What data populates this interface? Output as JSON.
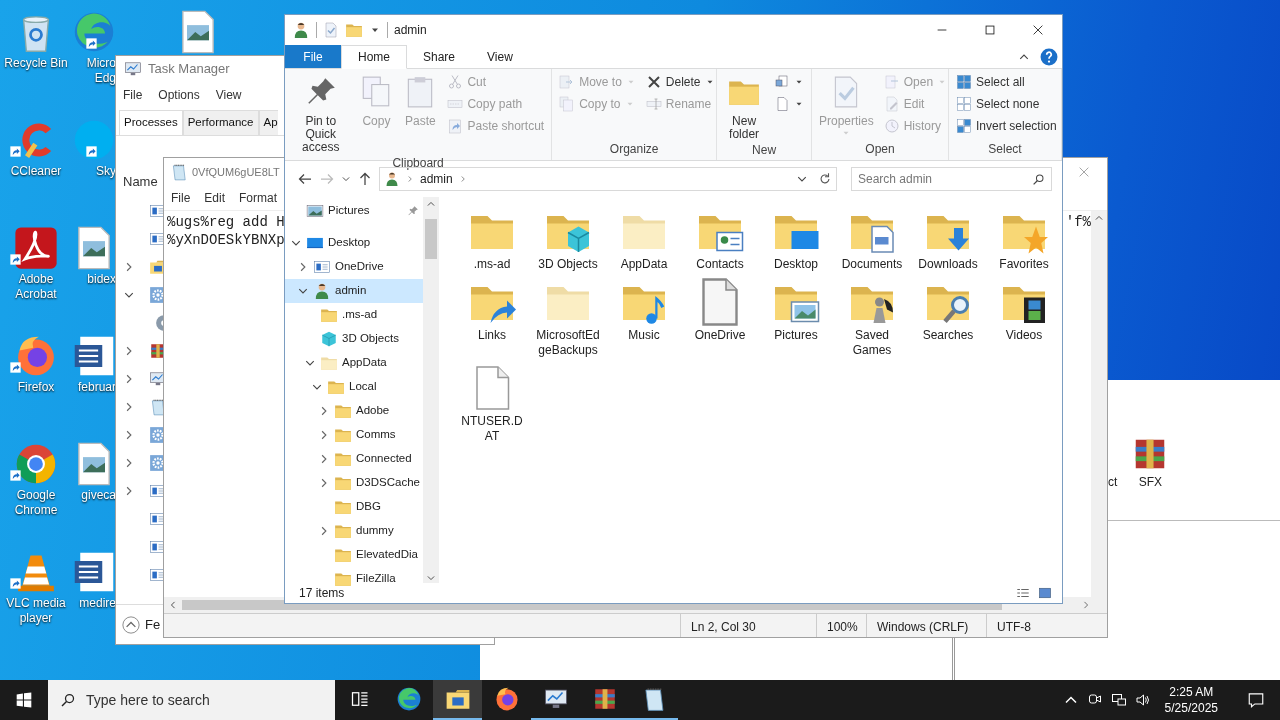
{
  "desktop_columns": [
    [
      {
        "label": "Recycle Bin",
        "kind": "recycle",
        "shortcut": false
      },
      {
        "label": "CCleaner",
        "kind": "ccleaner",
        "shortcut": true
      },
      {
        "label": "Adobe Acrobat",
        "kind": "acrobat",
        "shortcut": true
      },
      {
        "label": "Firefox",
        "kind": "firefox",
        "shortcut": true
      },
      {
        "label": "Google Chrome",
        "kind": "chrome",
        "shortcut": true
      },
      {
        "label": "VLC media player",
        "kind": "vlc",
        "shortcut": true
      }
    ],
    [
      {
        "label": "Micro Edg",
        "kind": "edge",
        "shortcut": true
      },
      {
        "label": "Sky",
        "kind": "skype",
        "shortcut": true
      },
      {
        "label": "bidex",
        "kind": "image",
        "shortcut": false
      },
      {
        "label": "februar",
        "kind": "word",
        "shortcut": false
      },
      {
        "label": "giveca",
        "kind": "image",
        "shortcut": false
      },
      {
        "label": "medire",
        "kind": "word",
        "shortcut": false
      }
    ],
    [
      {
        "kind": "image",
        "shortcut": false
      }
    ]
  ],
  "background_window": {
    "items": [
      {
        "label": "ct",
        "kind": "blank"
      },
      {
        "label": "SFX",
        "kind": "winrar"
      }
    ]
  },
  "task_manager": {
    "title": "Task Manager",
    "menu": [
      "File",
      "Options",
      "View"
    ],
    "tabs": [
      {
        "label": "Processes",
        "selected": true
      },
      {
        "label": "Performance",
        "selected": false
      },
      {
        "label": "Ap",
        "selected": false
      }
    ],
    "column": "Name",
    "rows": [
      {
        "kind": "app"
      },
      {
        "kind": "app"
      },
      {
        "kind": "explorer",
        "expanded": false
      },
      {
        "kind": "gear",
        "expanded": true,
        "children": [
          {
            "kind": "gearplain"
          }
        ]
      },
      {
        "kind": "winrar",
        "expanded": false
      },
      {
        "kind": "monitor",
        "expanded": false
      },
      {
        "kind": "notepad",
        "expanded": false
      },
      {
        "kind": "gear",
        "expanded": false
      },
      {
        "kind": "gear",
        "expanded": false
      },
      {
        "kind": "app",
        "expanded": false
      },
      {
        "kind": "app"
      },
      {
        "kind": "app"
      },
      {
        "kind": "app"
      }
    ],
    "footer": "Fe"
  },
  "notepad": {
    "title": "0VfQUM6gUE8LT",
    "menu": [
      "File",
      "Edit",
      "Format"
    ],
    "lines": [
      "%ugs%reg add H",
      "%yXnDOESkYBNXp"
    ],
    "line_tail": "'f%",
    "status": [
      "Ln 2, Col 30",
      "100%",
      "Windows (CRLF)",
      "UTF-8"
    ]
  },
  "explorer": {
    "title": "admin",
    "tabs": [
      {
        "label": "File",
        "kind": "file"
      },
      {
        "label": "Home",
        "kind": "tab",
        "selected": true
      },
      {
        "label": "Share",
        "kind": "tab",
        "selected": false
      },
      {
        "label": "View",
        "kind": "tab",
        "selected": false
      }
    ],
    "ribbon": [
      {
        "group": "Clipboard",
        "columns": [
          [
            {
              "label": "Pin to Quick access",
              "kind": "pin",
              "disabled": false
            }
          ],
          [
            {
              "label": "Copy",
              "kind": "copy",
              "disabled": true
            }
          ],
          [
            {
              "label": "Paste",
              "kind": "paste",
              "disabled": true
            }
          ],
          [
            {
              "label": "Cut",
              "kind": "cut",
              "disabled": true
            },
            {
              "label": "Copy path",
              "kind": "copypath",
              "disabled": true
            },
            {
              "label": "Paste shortcut",
              "kind": "pasteshortcut",
              "disabled": true
            }
          ]
        ]
      },
      {
        "group": "Organize",
        "columns": [
          [
            {
              "label": "Move to",
              "kind": "moveto",
              "disabled": true,
              "menu": true
            },
            {
              "label": "Copy to",
              "kind": "copyto",
              "disabled": true,
              "menu": true
            }
          ],
          [
            {
              "label": "Delete",
              "kind": "delete",
              "disabled": false,
              "menu": true
            },
            {
              "label": "Rename",
              "kind": "rename",
              "disabled": true
            }
          ]
        ]
      },
      {
        "group": "New",
        "columns": [
          [
            {
              "label": "New folder",
              "kind": "newfolder",
              "disabled": false
            }
          ],
          [
            {
              "kind": "newitem",
              "disabled": false,
              "menu": true
            },
            {
              "kind": "easyaccess",
              "disabled": false,
              "menu": true
            }
          ]
        ]
      },
      {
        "group": "Open",
        "columns": [
          [
            {
              "label": "Properties",
              "kind": "properties",
              "disabled": true,
              "menu": true
            }
          ],
          [
            {
              "label": "Open",
              "kind": "open",
              "disabled": true,
              "menu": true
            },
            {
              "label": "Edit",
              "kind": "edit",
              "disabled": true
            },
            {
              "label": "History",
              "kind": "history",
              "disabled": true
            }
          ]
        ]
      },
      {
        "group": "Select",
        "columns": [
          [
            {
              "label": "Select all",
              "kind": "selectall",
              "disabled": false
            },
            {
              "label": "Select none",
              "kind": "selectnone",
              "disabled": false
            },
            {
              "label": "Invert selection",
              "kind": "invert",
              "disabled": false
            }
          ]
        ]
      }
    ],
    "address": [
      "admin"
    ],
    "search": {
      "placeholder": "Search admin"
    },
    "nav": [
      {
        "label": "Pictures",
        "kind": "picturesnav",
        "pinned": true,
        "selected": false
      },
      {
        "label": "Desktop",
        "kind": "desktopmon",
        "expanded": true,
        "selected": false,
        "children": [
          {
            "label": "OneDrive",
            "kind": "app",
            "expanded": false,
            "selected": false
          },
          {
            "label": "admin",
            "kind": "user",
            "expanded": true,
            "selected": true,
            "children": [
              {
                "label": ".ms-ad",
                "kind": "folder",
                "selected": false
              },
              {
                "label": "3D Objects",
                "kind": "cube",
                "selected": false
              },
              {
                "label": "AppData",
                "kind": "folderfaded",
                "expanded": true,
                "selected": false,
                "children": [
                  {
                    "label": "Local",
                    "kind": "folder",
                    "expanded": true,
                    "selected": false,
                    "children": [
                      {
                        "label": "Adobe",
                        "kind": "folder",
                        "expanded": false,
                        "selected": false
                      },
                      {
                        "label": "Comms",
                        "kind": "folder",
                        "expanded": false,
                        "selected": false
                      },
                      {
                        "label": "Connected",
                        "kind": "folder",
                        "expanded": false,
                        "selected": false
                      },
                      {
                        "label": "D3DSCache",
                        "kind": "folder",
                        "expanded": false,
                        "selected": false
                      },
                      {
                        "label": "DBG",
                        "kind": "folder",
                        "selected": false
                      },
                      {
                        "label": "dummy",
                        "kind": "folder",
                        "expanded": false,
                        "selected": false
                      },
                      {
                        "label": "ElevatedDia",
                        "kind": "folder",
                        "selected": false
                      },
                      {
                        "label": "FileZilla",
                        "kind": "folder",
                        "selected": false
                      }
                    ]
                  }
                ]
              }
            ]
          }
        ]
      }
    ],
    "items": [
      {
        "label": ".ms-ad",
        "kind": "folder"
      },
      {
        "label": "3D Objects",
        "kind": "folder3d"
      },
      {
        "label": "AppData",
        "kind": "folderfaded"
      },
      {
        "label": "Contacts",
        "kind": "contacts"
      },
      {
        "label": "Desktop",
        "kind": "desktop"
      },
      {
        "label": "Documents",
        "kind": "documents"
      },
      {
        "label": "Downloads",
        "kind": "downloads"
      },
      {
        "label": "Favorites",
        "kind": "favorites"
      },
      {
        "label": "Links",
        "kind": "links"
      },
      {
        "label": "MicrosoftEdgeBackups",
        "kind": "folderfaded"
      },
      {
        "label": "Music",
        "kind": "music"
      },
      {
        "label": "OneDrive",
        "kind": "bigfile"
      },
      {
        "label": "Pictures",
        "kind": "pictures"
      },
      {
        "label": "Saved Games",
        "kind": "games"
      },
      {
        "label": "Searches",
        "kind": "searches"
      },
      {
        "label": "Videos",
        "kind": "videos"
      },
      {
        "label": "NTUSER.DAT",
        "kind": "file"
      }
    ],
    "status": "17 items"
  },
  "taskbar": {
    "search": {
      "placeholder": "Type here to search"
    },
    "apps": [
      {
        "kind": "edge",
        "selected": false,
        "running": false
      },
      {
        "kind": "explorer",
        "selected": true,
        "running": true
      },
      {
        "kind": "firefox",
        "selected": false,
        "running": false
      },
      {
        "kind": "monitor",
        "selected": false,
        "running": true
      },
      {
        "kind": "winrar",
        "selected": false,
        "running": true
      },
      {
        "kind": "notepad",
        "selected": false,
        "running": true
      }
    ],
    "time": "2:25 AM",
    "date": "5/25/2025"
  }
}
